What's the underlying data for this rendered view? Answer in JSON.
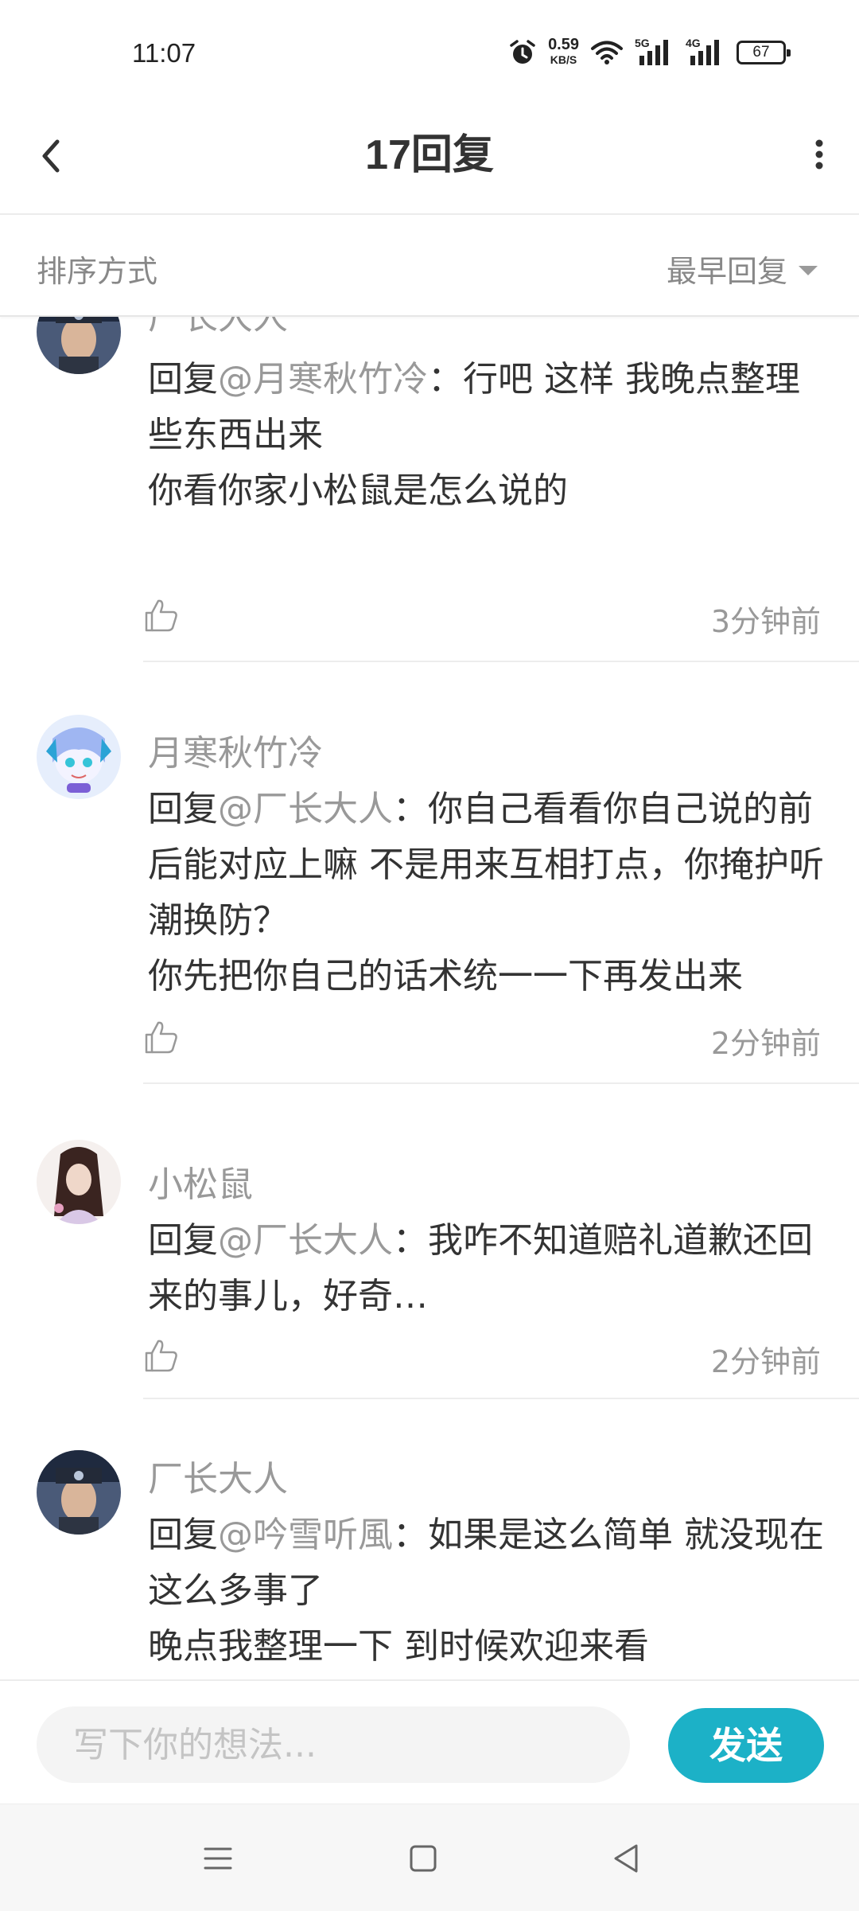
{
  "status_bar": {
    "time": "11:07",
    "speed_value": "0.59",
    "speed_unit": "KB/S",
    "net1": "5G",
    "net2": "4G",
    "battery": "67"
  },
  "header": {
    "title": "17回复"
  },
  "sort": {
    "label": "排序方式",
    "selected": "最早回复"
  },
  "comments": [
    {
      "name": "厂长大人",
      "reply_prefix": "回复",
      "mention": "@月寒秋竹冷",
      "text": "：行吧 这样 我晚点整理些东西出来\n你看你家小松鼠是怎么说的",
      "time": "3分钟前"
    },
    {
      "name": "月寒秋竹冷",
      "reply_prefix": "回复",
      "mention": "@厂长大人",
      "text": "：你自己看看你自己说的前后能对应上嘛 不是用来互相打点，你掩护听潮换防？\n你先把你自己的话术统一一下再发出来",
      "time": "2分钟前"
    },
    {
      "name": "小松鼠",
      "reply_prefix": "回复",
      "mention": "@厂长大人",
      "text": "：我咋不知道赔礼道歉还回来的事儿，好奇…",
      "time": "2分钟前"
    },
    {
      "name": "厂长大人",
      "reply_prefix": "回复",
      "mention": "@吟雪听風",
      "text": "：如果是这么简单 就没现在这么多事了\n晚点我整理一下 到时候欢迎来看",
      "time": ""
    }
  ],
  "input": {
    "placeholder": "写下你的想法...",
    "send_label": "发送"
  },
  "colors": {
    "accent": "#1cb1c7",
    "meta_text": "#999999",
    "body_text": "#333333"
  },
  "icons": {
    "back": "chevron-left-icon",
    "more": "more-vertical-icon",
    "like": "thumbs-up-icon",
    "nav_menu": "menu-icon",
    "nav_home": "square-home-icon",
    "nav_back": "triangle-back-icon"
  }
}
